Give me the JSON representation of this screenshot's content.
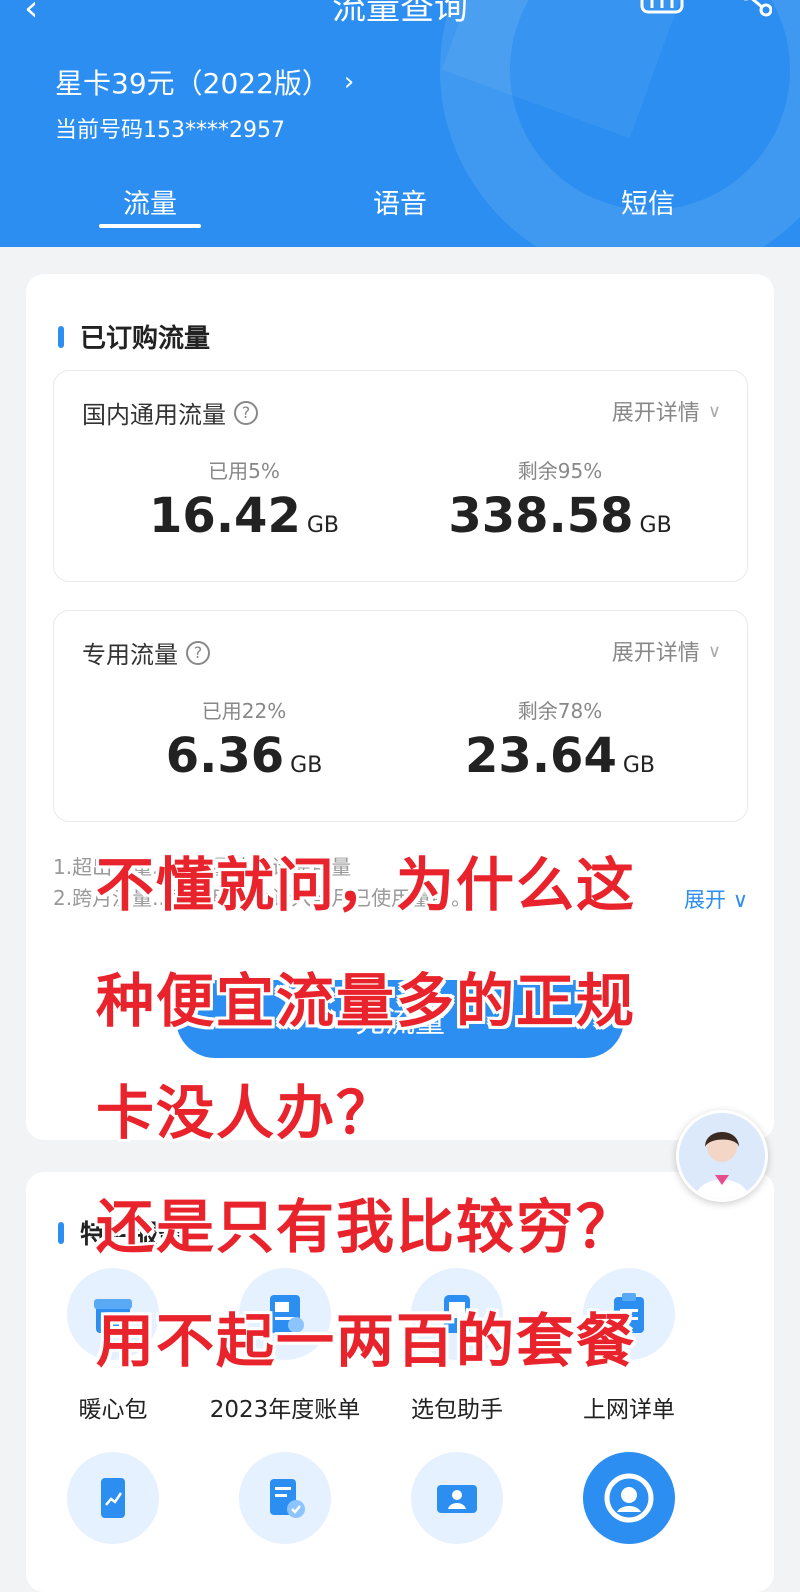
{
  "header": {
    "title": "流量查询",
    "plan_name": "星卡39元（2022版）",
    "phone": "当前号码153****2957",
    "tabs": [
      "流量",
      "语音",
      "短信"
    ],
    "active_tab": "流量"
  },
  "purchased": {
    "section_title": "已订购流量",
    "expand_label": "展开详情",
    "boxes": [
      {
        "label": "国内通用流量",
        "used_pct": "已用5%",
        "used_val": "16.42",
        "remain_pct": "剩余95%",
        "remain_val": "338.58",
        "unit": "GB"
      },
      {
        "label": "专用流量",
        "used_pct": "已用22%",
        "used_val": "6.36",
        "remain_pct": "剩余78%",
        "remain_val": "23.64",
        "unit": "GB"
      }
    ],
    "notes": [
      "1.超出流量...外流量的累计使用量",
      "2.跨月流量...已使用量会计入当月已使用量中。"
    ],
    "notes_expand": "展开",
    "cta": "充流量"
  },
  "services": {
    "section_title": "特色服务",
    "items": [
      {
        "label": "暖心包",
        "icon": "gift-heart-icon"
      },
      {
        "label": "2023年度账单",
        "icon": "annual-bill-icon"
      },
      {
        "label": "选包助手",
        "icon": "package-helper-icon"
      },
      {
        "label": "上网详单",
        "icon": "clipboard-icon"
      },
      {
        "label": "",
        "icon": "phone-chart-icon"
      },
      {
        "label": "",
        "icon": "doc-check-icon"
      },
      {
        "label": "",
        "icon": "id-card-icon"
      },
      {
        "label": "",
        "icon": "support-agent-icon"
      }
    ]
  },
  "overlay_text": [
    "不懂就问，为什么这",
    "种便宜流量多的正规",
    "卡没人办？",
    "还是只有我比较穷？",
    "用不起一两百的套餐"
  ],
  "colors": {
    "brand": "#2b8ef0",
    "overlay_red": "#e8232b",
    "background": "#f2f3f5"
  }
}
